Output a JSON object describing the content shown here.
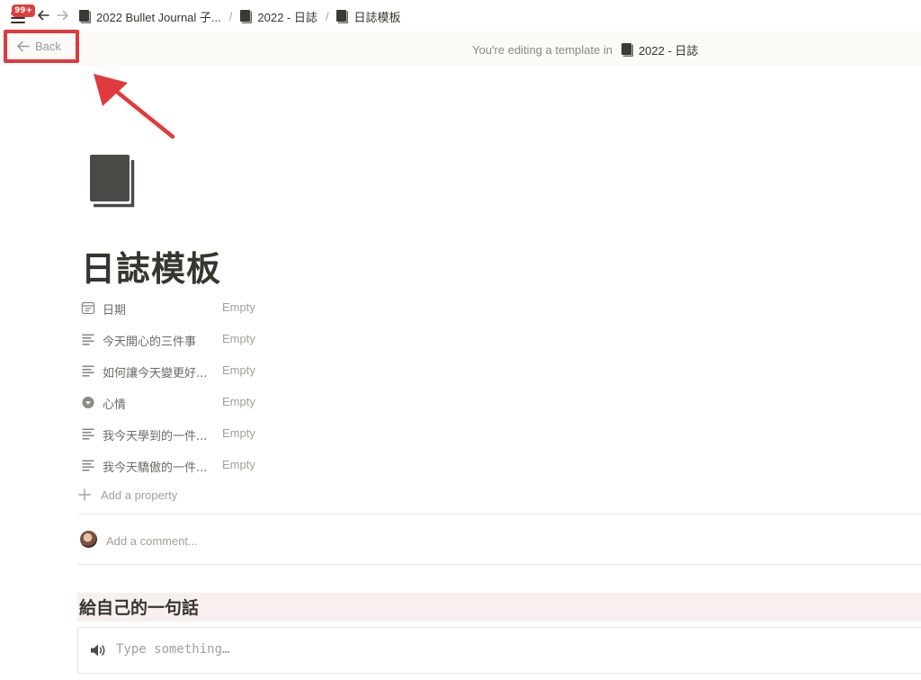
{
  "topbar": {
    "notification_badge": "99+",
    "breadcrumbs": [
      {
        "label": "2022 Bullet Journal 子..."
      },
      {
        "label": "2022 - 日誌"
      },
      {
        "label": "日誌模板"
      }
    ],
    "separator": "/"
  },
  "banner": {
    "back_label": "Back",
    "editing_text": "You're editing a template in",
    "target_label": "2022 - 日誌"
  },
  "page": {
    "title": "日誌模板",
    "properties": [
      {
        "name": "日期",
        "value": "Empty",
        "icon": "calendar-icon"
      },
      {
        "name": "今天開心的三件事",
        "value": "Empty",
        "icon": "text-lines-icon"
      },
      {
        "name": "如何讓今天變更好...",
        "value": "Empty",
        "icon": "text-lines-icon"
      },
      {
        "name": "心情",
        "value": "Empty",
        "icon": "select-circle-icon"
      },
      {
        "name": "我今天學到的一件...",
        "value": "Empty",
        "icon": "text-lines-icon"
      },
      {
        "name": "我今天驕傲的一件...",
        "value": "Empty",
        "icon": "text-lines-icon"
      }
    ],
    "add_property_label": "Add a property",
    "comment_placeholder": "Add a comment...",
    "heading": "給自己的一句話",
    "input_placeholder": "Type something…"
  },
  "colors": {
    "annotation_red": "#e0393e",
    "badge_red": "#e03e3e",
    "text_primary": "#37352f",
    "text_muted": "#a19f9a",
    "banner_bg": "#fbfaf6",
    "heading_bg": "#f7f0ee"
  }
}
